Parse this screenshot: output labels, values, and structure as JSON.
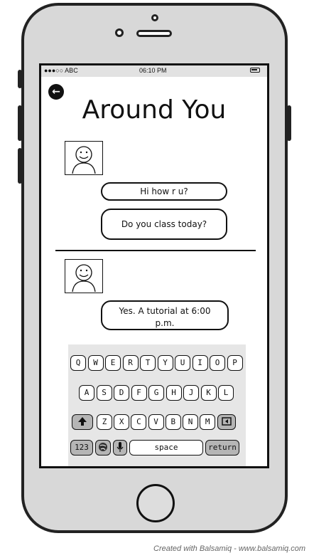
{
  "status_bar": {
    "carrier": "●●●○○ ABC",
    "time": "06:10 PM",
    "battery_icon": "battery-icon"
  },
  "header": {
    "back_icon": "back-arrow-icon",
    "back_glyph": "←",
    "title": "Around You"
  },
  "messages": [
    {
      "avatar_icon": "smiley-avatar-icon",
      "bubbles": [
        "Hi how r u?",
        "Do you class today?"
      ]
    },
    {
      "avatar_icon": "smiley-avatar-icon",
      "bubbles": [
        "Yes. A tutorial at 6:00 p.m."
      ]
    }
  ],
  "keyboard": {
    "row1": [
      "Q",
      "W",
      "E",
      "R",
      "T",
      "Y",
      "U",
      "I",
      "O",
      "P"
    ],
    "row2": [
      "A",
      "S",
      "D",
      "F",
      "G",
      "H",
      "J",
      "K",
      "L"
    ],
    "row3": [
      "Z",
      "X",
      "C",
      "V",
      "B",
      "N",
      "M"
    ],
    "shift_icon": "shift-arrow-icon",
    "backspace_icon": "backspace-icon",
    "numbers_label": "123",
    "globe_icon": "globe-icon",
    "mic_icon": "microphone-icon",
    "space_label": "space",
    "return_label": "return"
  },
  "footer": "Created with Balsamiq - www.balsamiq.com"
}
